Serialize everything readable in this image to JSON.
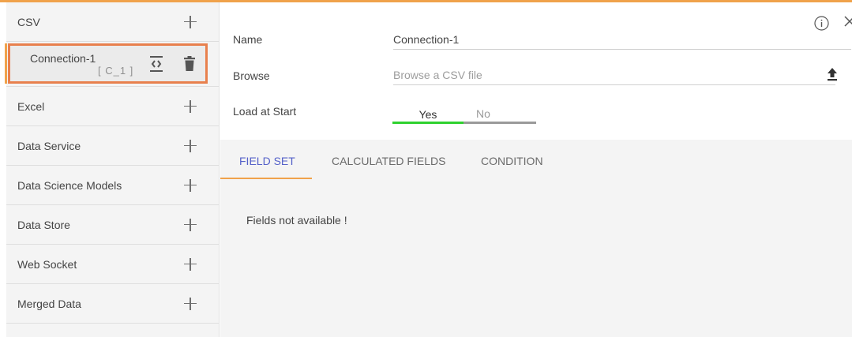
{
  "sidebar": {
    "csv": {
      "label": "CSV"
    },
    "connection": {
      "name": "Connection-1",
      "code": "[ C_1 ]"
    },
    "items": [
      {
        "label": "Excel"
      },
      {
        "label": "Data Service"
      },
      {
        "label": "Data Science Models"
      },
      {
        "label": "Data Store"
      },
      {
        "label": "Web Socket"
      },
      {
        "label": "Merged Data"
      }
    ]
  },
  "form": {
    "name_label": "Name",
    "name_value": "Connection-1",
    "browse_label": "Browse",
    "browse_placeholder": "Browse a CSV file",
    "load_label": "Load at Start",
    "toggle_yes": "Yes",
    "toggle_no": "No",
    "toggle_selected": "Yes"
  },
  "tabs": [
    {
      "label": "FIELD SET",
      "active": true
    },
    {
      "label": "CALCULATED FIELDS",
      "active": false
    },
    {
      "label": "CONDITION",
      "active": false
    }
  ],
  "panel": {
    "empty_message": "Fields not available !"
  },
  "colors": {
    "accent": "#f0a24b",
    "selection_border": "#e8804d",
    "active_tab": "#5561c9",
    "toggle_on": "#2fd12f"
  },
  "icons": [
    "plus-icon",
    "code-icon",
    "trash-icon",
    "info-icon",
    "close-icon",
    "upload-icon"
  ]
}
